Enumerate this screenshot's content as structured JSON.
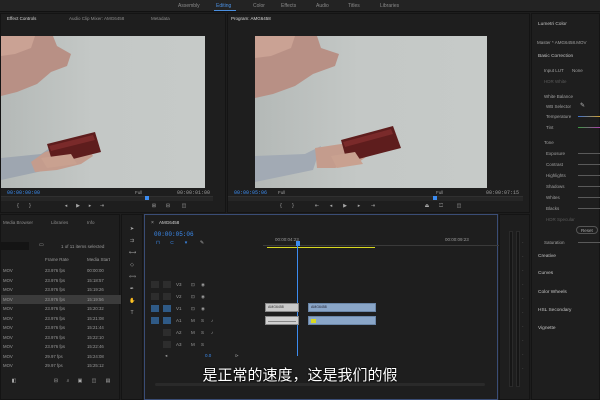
{
  "workspaces": [
    "Assembly",
    "Editing",
    "Color",
    "Effects",
    "Audio",
    "Titles",
    "Libraries"
  ],
  "source_panel": {
    "tabs": [
      "Effect Controls",
      "Audio Clip Mixer: AMG6458",
      "Metadata"
    ],
    "timecode_in": "00:00:00:00",
    "zoom": "Full",
    "timecode_out": "00:00:01:00"
  },
  "program_panel": {
    "tab": "Program: AMG6458",
    "timecode": "00:00:05:06",
    "zoom": "Full",
    "scale": "Full",
    "duration": "00:00:07:15"
  },
  "lumetri": {
    "title": "Lumetri Color",
    "master": "Master * AMG6458.MOV",
    "section_basic": "Basic Correction",
    "input_lut": "Input LUT",
    "input_lut_value": "None",
    "hdr_white": "HDR White",
    "white_balance": "White Balance",
    "wb_selector": "WB Selector",
    "temperature": "Temperature",
    "tint": "Tint",
    "tone": "Tone",
    "exposure": "Exposure",
    "contrast": "Contrast",
    "highlights": "Highlights",
    "shadows": "Shadows",
    "whites": "Whites",
    "blacks": "Blacks",
    "hdr_specular": "HDR Specular",
    "reset": "Reset",
    "saturation": "Saturation",
    "creative": "Creative",
    "curves": "Curves",
    "color_wheels": "Color Wheels",
    "hsl_secondary": "HSL Secondary",
    "vignette": "Vignette"
  },
  "project_panel": {
    "tabs": [
      "Media Browser",
      "Libraries",
      "Info"
    ],
    "items_selected": "1 of 11 items selected",
    "col_frame_rate": "Frame Rate",
    "col_media_start": "Media Start",
    "rows": [
      {
        "name": "MOV",
        "fps": "23.976 fps",
        "start": "00:00:00"
      },
      {
        "name": "MOV",
        "fps": "23.976 fps",
        "start": "15:18:57"
      },
      {
        "name": "MOV",
        "fps": "23.976 fps",
        "start": "15:19:26"
      },
      {
        "name": "MOV",
        "fps": "23.976 fps",
        "start": "15:19:56"
      },
      {
        "name": "MOV",
        "fps": "23.976 fps",
        "start": "15:20:32"
      },
      {
        "name": "MOV",
        "fps": "23.976 fps",
        "start": "15:21:08"
      },
      {
        "name": "MOV",
        "fps": "23.976 fps",
        "start": "15:21:44"
      },
      {
        "name": "MOV",
        "fps": "23.976 fps",
        "start": "15:22:10"
      },
      {
        "name": "MOV",
        "fps": "23.976 fps",
        "start": "15:22:46"
      },
      {
        "name": "MOV",
        "fps": "29.97 fps",
        "start": "15:24:08"
      },
      {
        "name": "MOV",
        "fps": "29.97 fps",
        "start": "15:25:12"
      }
    ]
  },
  "timeline": {
    "tab": "AMG6458",
    "timecode": "00:00:05:06",
    "ruler_mark": "00:00:04:23",
    "ruler_end": "00:00:09:23",
    "tracks_v": [
      "V3",
      "V2",
      "V1"
    ],
    "tracks_a": [
      "A1",
      "A2",
      "A3"
    ],
    "clip_v1_label": "AMG6458",
    "clip_v2_label": "AMG6458"
  },
  "subtitle": "是正常的速度，这是我们的假",
  "colors": {
    "accent": "#3c8cf0",
    "clip_video": "#8aa6c8",
    "clip_audio": "#3f8a6f",
    "clip_adjust": "#c9c9c9"
  }
}
